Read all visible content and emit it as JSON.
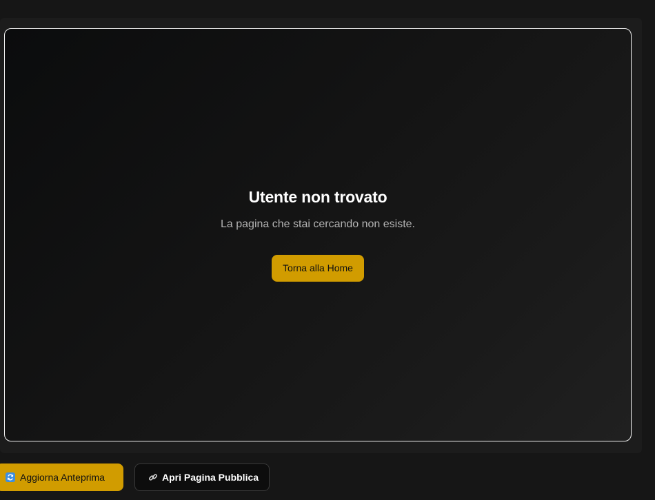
{
  "preview": {
    "title": "Utente non trovato",
    "message": "La pagina che stai cercando non esiste.",
    "home_button": "Torna alla Home"
  },
  "toolbar": {
    "refresh_label": "Aggiorna Anteprima",
    "refresh_icon": "refresh-icon",
    "open_public_label": "Apri Pagina Pubblica",
    "open_public_icon": "link-icon"
  },
  "colors": {
    "accent": "#d19c00",
    "background": "#161616",
    "text": "#ffffff",
    "muted_text": "#b3b3b3"
  }
}
